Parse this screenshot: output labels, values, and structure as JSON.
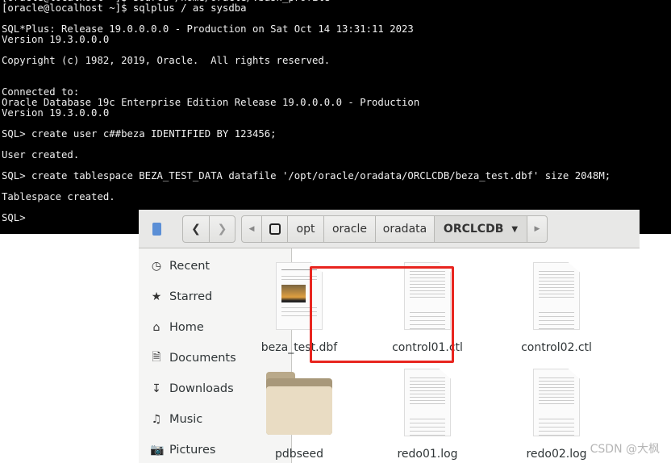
{
  "terminal": {
    "lines": [
      "[oracle@localhost ~]$ source /home/oracle/.bash_profile",
      "[oracle@localhost ~]$ sqlplus / as sysdba",
      "",
      "SQL*Plus: Release 19.0.0.0.0 - Production on Sat Oct 14 13:31:11 2023",
      "Version 19.3.0.0.0",
      "",
      "Copyright (c) 1982, 2019, Oracle.  All rights reserved.",
      "",
      "",
      "Connected to:",
      "Oracle Database 19c Enterprise Edition Release 19.0.0.0.0 - Production",
      "Version 19.3.0.0.0",
      "",
      "SQL> create user c##beza IDENTIFIED BY 123456;",
      "",
      "User created.",
      "",
      "SQL> create tablespace BEZA_TEST_DATA datafile '/opt/oracle/oradata/ORCLCDB/beza_test.dbf' size 2048M;",
      "",
      "Tablespace created.",
      "",
      "SQL> "
    ]
  },
  "filemanager": {
    "path": [
      "opt",
      "oracle",
      "oradata",
      "ORCLCDB"
    ],
    "sidebar": [
      {
        "label": "Recent",
        "icon": "clock-icon"
      },
      {
        "label": "Starred",
        "icon": "star-icon"
      },
      {
        "label": "Home",
        "icon": "home-icon"
      },
      {
        "label": "Documents",
        "icon": "document-icon"
      },
      {
        "label": "Downloads",
        "icon": "download-icon"
      },
      {
        "label": "Music",
        "icon": "music-icon"
      },
      {
        "label": "Pictures",
        "icon": "camera-icon"
      }
    ],
    "files": [
      {
        "name": "beza_test.dbf",
        "type": "image-doc",
        "selected": true
      },
      {
        "name": "control01.ctl",
        "type": "text"
      },
      {
        "name": "control02.ctl",
        "type": "text"
      },
      {
        "name": "pdbseed",
        "type": "folder"
      },
      {
        "name": "redo01.log",
        "type": "text"
      },
      {
        "name": "redo02.log",
        "type": "text"
      }
    ],
    "highlight_color": "#e8251f"
  },
  "watermark": "CSDN @大枫"
}
